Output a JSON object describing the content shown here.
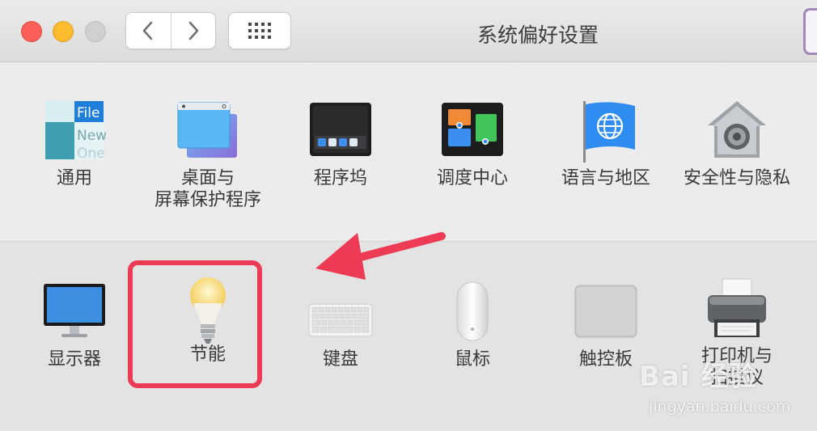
{
  "window": {
    "title": "系统偏好设置",
    "nav": {
      "back_icon": "chevron-left-icon",
      "forward_icon": "chevron-right-icon",
      "grid_icon": "grid-icon"
    }
  },
  "row1": [
    {
      "label": "通用",
      "icon": "general-icon"
    },
    {
      "label": "桌面与",
      "label2": "屏幕保护程序",
      "icon": "desktop-screensaver-icon"
    },
    {
      "label": "程序坞",
      "icon": "dock-icon"
    },
    {
      "label": "调度中心",
      "icon": "mission-control-icon"
    },
    {
      "label": "语言与地区",
      "icon": "language-region-icon"
    },
    {
      "label": "安全性与隐私",
      "icon": "security-privacy-icon"
    }
  ],
  "row2": [
    {
      "label": "显示器",
      "icon": "display-icon"
    },
    {
      "label": "节能",
      "icon": "energy-saver-icon"
    },
    {
      "label": "键盘",
      "icon": "keyboard-icon"
    },
    {
      "label": "鼠标",
      "icon": "mouse-icon"
    },
    {
      "label": "触控板",
      "icon": "trackpad-icon"
    },
    {
      "label": "打印机与",
      "label2": "扫描仪",
      "icon": "printer-icon"
    }
  ],
  "general_icon_text": {
    "line1": "File",
    "line2": "New",
    "line3": "One"
  },
  "watermark": {
    "brand": "Bai  经验",
    "zh": "",
    "sub": "jingyan.baidu.com"
  },
  "colors": {
    "highlight": "#ed3a55",
    "accent_blue": "#2f8cf0"
  }
}
